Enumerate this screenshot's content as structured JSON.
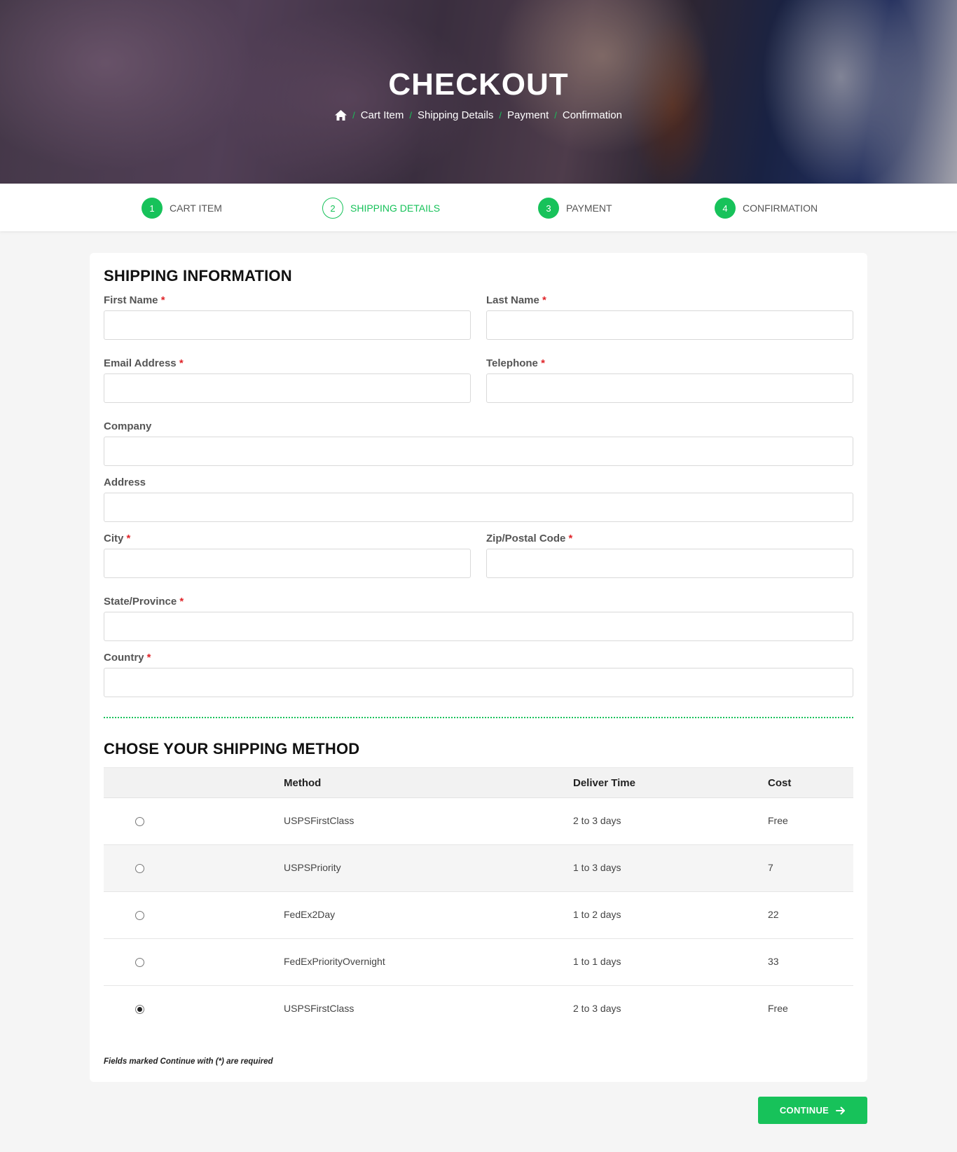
{
  "hero": {
    "title": "CHECKOUT",
    "breadcrumb": [
      "Cart Item",
      "Shipping Details",
      "Payment",
      "Confirmation"
    ],
    "home_icon": "home-icon",
    "separator": "/"
  },
  "steps": [
    {
      "number": "1",
      "label": "CART ITEM",
      "active": false
    },
    {
      "number": "2",
      "label": "SHIPPING DETAILS",
      "active": true
    },
    {
      "number": "3",
      "label": "PAYMENT",
      "active": false
    },
    {
      "number": "4",
      "label": "CONFIRMATION",
      "active": false
    }
  ],
  "shipping_info": {
    "title": "SHIPPING INFORMATION",
    "fields": {
      "first_name": {
        "label": "First Name",
        "required": "*",
        "value": ""
      },
      "last_name": {
        "label": "Last Name",
        "required": "*",
        "value": ""
      },
      "email": {
        "label": "Email Address",
        "required": "*",
        "value": ""
      },
      "telephone": {
        "label": "Telephone",
        "required": "*",
        "value": ""
      },
      "company": {
        "label": "Company",
        "value": ""
      },
      "address": {
        "label": "Address",
        "value": ""
      },
      "city": {
        "label": "City",
        "required": "*",
        "value": ""
      },
      "zip": {
        "label": "Zip/Postal Code",
        "required": "*",
        "value": ""
      },
      "state": {
        "label": "State/Province",
        "required": "*",
        "value": ""
      },
      "country": {
        "label": "Country",
        "required": "*",
        "value": ""
      }
    }
  },
  "shipping_method": {
    "title": "CHOSE YOUR SHIPPING METHOD",
    "columns": {
      "method": "Method",
      "time": "Deliver Time",
      "cost": "Cost"
    },
    "rows": [
      {
        "method": "USPSFirstClass",
        "time": "2 to 3 days",
        "cost": "Free",
        "selected": false
      },
      {
        "method": "USPSPriority",
        "time": "1 to 3 days",
        "cost": "7",
        "selected": false
      },
      {
        "method": "FedEx2Day",
        "time": "1 to 2 days",
        "cost": "22",
        "selected": false
      },
      {
        "method": "FedExPriorityOvernight",
        "time": "1 to 1 days",
        "cost": "33",
        "selected": false
      },
      {
        "method": "USPSFirstClass",
        "time": "2 to 3 days",
        "cost": "Free",
        "selected": true
      }
    ]
  },
  "note": "Fields marked Continue with (*) are required",
  "continue": {
    "label": "CONTINUE",
    "icon": "arrow-right-icon"
  },
  "colors": {
    "accent": "#17c25a",
    "required": "#e0252a"
  }
}
